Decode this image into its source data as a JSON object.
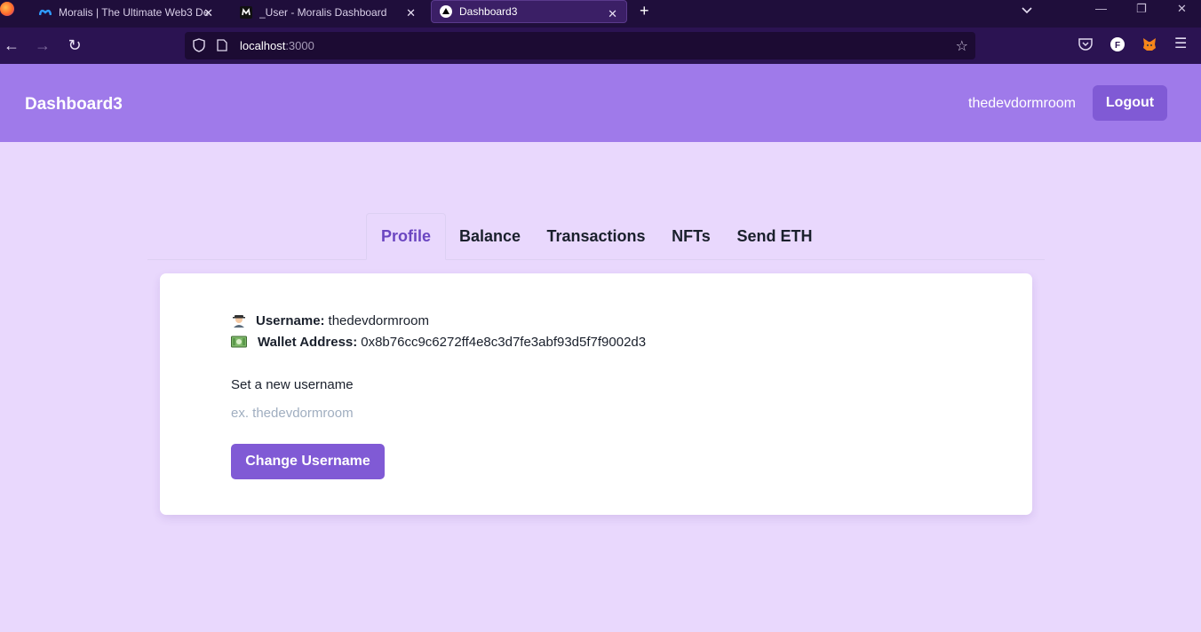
{
  "browser": {
    "tabs": [
      {
        "title": "Moralis | The Ultimate Web3 De",
        "favicon": "moralis-logo-icon",
        "active": false
      },
      {
        "title": "_User - Moralis Dashboard",
        "favicon": "moralis-m-icon",
        "active": false
      },
      {
        "title": "Dashboard3",
        "favicon": "triangle-icon",
        "active": true
      }
    ],
    "url_host": "localhost",
    "url_port": ":3000"
  },
  "header": {
    "brand": "Dashboard3",
    "username": "thedevdormroom",
    "logout_label": "Logout"
  },
  "tabs": [
    "Profile",
    "Balance",
    "Transactions",
    "NFTs",
    "Send ETH"
  ],
  "profile": {
    "username_label": "Username:",
    "username_value": "thedevdormroom",
    "wallet_label": "Wallet Address:",
    "wallet_value": "0x8b76cc9c6272ff4e8c3d7fe3abf93d5f7f9002d3",
    "set_label": "Set a new username",
    "input_placeholder": "ex. thedevdormroom",
    "input_value": "",
    "button_label": "Change Username"
  },
  "colors": {
    "header_bg": "#9f7aea",
    "page_bg": "#e9d8fd",
    "accent": "#805ad5",
    "selected_tab": "#6b46c1"
  }
}
